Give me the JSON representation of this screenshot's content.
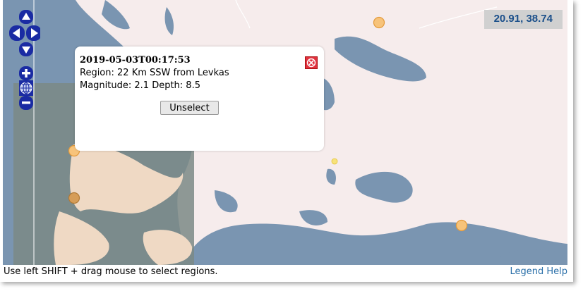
{
  "coordinates_readout": "20.91, 38.74",
  "popup": {
    "time": "2019-05-03T00:17:53",
    "region": "Region: 22 Km SSW from Levkas",
    "magnitude_depth": "Magnitude: 2.1 Depth: 8.5",
    "unselect_label": "Unselect"
  },
  "footer": {
    "hint": "Use left SHIFT + drag mouse to select regions.",
    "legend_link": "Legend",
    "help_link": "Help"
  },
  "colors": {
    "sea": "#7a95b1",
    "land": "#f6ecec",
    "selection_overlay": "#7b8a86",
    "event_marker": "#f7c37a",
    "control_blue": "#1a2ba3",
    "close_red": "#e0303d"
  }
}
